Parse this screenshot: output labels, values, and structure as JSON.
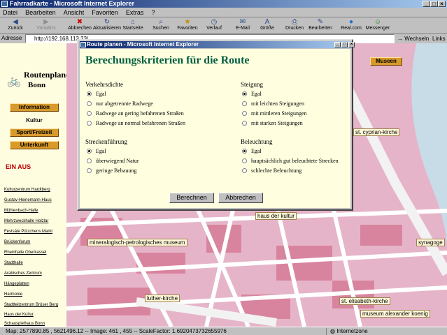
{
  "window": {
    "title": "Fahrradkarte - Microsoft Internet Explorer"
  },
  "menu": [
    "Datei",
    "Bearbeiten",
    "Ansicht",
    "Favoriten",
    "Extras",
    "?"
  ],
  "toolbar": [
    {
      "label": "Zurück",
      "icon": "back-arrow-icon",
      "enabled": true
    },
    {
      "label": "Vorwärts",
      "icon": "forward-arrow-icon",
      "enabled": false
    },
    {
      "label": "Abbrechen",
      "icon": "stop-icon",
      "enabled": true
    },
    {
      "label": "Aktualisieren",
      "icon": "refresh-icon",
      "enabled": true
    },
    {
      "label": "Startseite",
      "icon": "home-icon",
      "enabled": true
    },
    {
      "label": "Suchen",
      "icon": "search-icon",
      "enabled": true
    },
    {
      "label": "Favoriten",
      "icon": "favorites-icon",
      "enabled": true
    },
    {
      "label": "Verlauf",
      "icon": "history-icon",
      "enabled": true
    },
    {
      "label": "E-Mail",
      "icon": "mail-icon",
      "enabled": true
    },
    {
      "label": "Größe",
      "icon": "font-size-icon",
      "enabled": true
    },
    {
      "label": "Drucken",
      "icon": "print-icon",
      "enabled": true
    },
    {
      "label": "Bearbeiten",
      "icon": "edit-icon",
      "enabled": true
    },
    {
      "label": "Real.com",
      "icon": "real-icon",
      "enabled": true
    },
    {
      "label": "Messenger",
      "icon": "messenger-icon",
      "enabled": true
    }
  ],
  "address": {
    "label": "Adresse",
    "value": "http://192.168.113.23/...",
    "go_label": "Wechseln zu",
    "links_label": "Links"
  },
  "sidebar": {
    "logo_line1": "Routenplaner",
    "logo_line2": "Bonn",
    "nav": [
      {
        "label": "Information",
        "active": false
      },
      {
        "label": "Kultur",
        "active": true
      },
      {
        "label": "Sport/Freizeit",
        "active": false
      },
      {
        "label": "Unterkunft",
        "active": false
      }
    ],
    "ein_aus": "EIN AUS",
    "poi_list": [
      "Kulturzentrum Hardtberg",
      "Gustav-Heinemann-Haus",
      "Mühlenbach-Halle",
      "Mehrzweckhalle Holzlar",
      "Festsäle Pützchens Markt",
      "Brückenforum",
      "Rheinhalle Oberkassel",
      "Stadthalle",
      "Arabisches Zentrum",
      "Hängeplatten",
      "Harmonie",
      "Stadtteilzentrum Brüser Berg",
      "Haus der Kultur",
      "Schauspielhaus Bonn"
    ]
  },
  "map": {
    "museen_label": "Museen",
    "labels": [
      "st. cyprian-kirche",
      "haus der kultur",
      "mineralogisch-petrologisches museum",
      "synagoge",
      "luther-kirche",
      "st. elisabeth-kirche",
      "museum alexander koenig"
    ]
  },
  "dialog": {
    "title": "Route planen - Microsoft Internet Explorer",
    "heading": "Berechungskriterien für die Route",
    "groups": [
      {
        "title": "Verkehrsdichte",
        "options": [
          "Egal",
          "nur abgetrennte Radwege",
          "Radwege an gering befahrenen Straßen",
          "Radwege an normal befahrenen Straßen"
        ],
        "selected": 0
      },
      {
        "title": "Steigung",
        "options": [
          "Egal",
          "mit leichten Steigungen",
          "mit mittleren Steigungen",
          "mit starken Steigungen"
        ],
        "selected": 0
      },
      {
        "title": "Streckenführung",
        "options": [
          "Egal",
          "überwiegend Natur",
          "geringe Bebauung"
        ],
        "selected": 0
      },
      {
        "title": "Beleuchtung",
        "options": [
          "Egal",
          "hauptsächlich gut beleuchtete Strecken",
          "schlechte Beleuchtung"
        ],
        "selected": 0
      }
    ],
    "calc_button": "Berechnen",
    "cancel_button": "Abbrechen"
  },
  "status": {
    "text": "Map: 2577890.85 , 5621496.12 -- Image: 461 , 455 -- ScaleFactor: 1.6920473732655976",
    "zone": "Internetzone"
  },
  "colors": {
    "titlebar": "#0a246a",
    "accent": "#d89a2a",
    "heading": "#006040",
    "map_bg": "#e6b4c8"
  }
}
